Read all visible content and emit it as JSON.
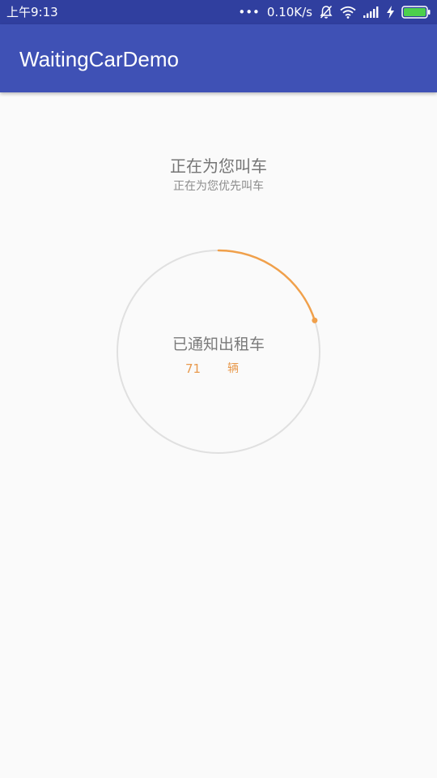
{
  "status_bar": {
    "time": "上午9:13",
    "more": "•••",
    "net_speed": "0.10K/s",
    "icons": [
      "notifications-off-icon",
      "wifi-icon",
      "signal-icon",
      "charging-bolt-icon",
      "battery-icon"
    ]
  },
  "app_bar": {
    "title": "WaitingCarDemo",
    "color": "#3f51b5",
    "status_color": "#303f9f"
  },
  "main": {
    "headline": "正在为您叫车",
    "subline": "正在为您优先叫车",
    "progress": {
      "label": "已通知出租车",
      "count": "71",
      "unit": "辆",
      "fraction": 0.2,
      "arc_color": "#f0a04b",
      "track_color": "#e0e0e0"
    }
  }
}
